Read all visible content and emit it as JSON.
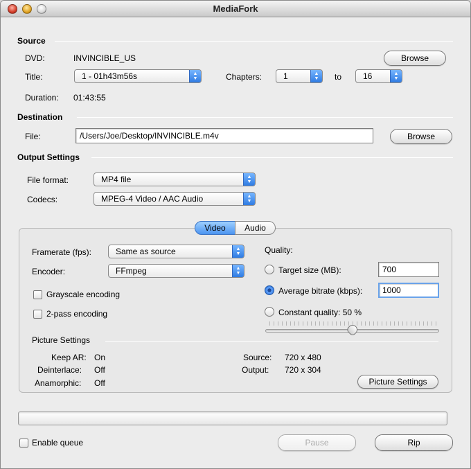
{
  "window": {
    "title": "MediaFork"
  },
  "source": {
    "heading": "Source",
    "dvd_label": "DVD:",
    "dvd_value": "INVINCIBLE_US",
    "title_label": "Title:",
    "title_value": "1 - 01h43m56s",
    "chapters_label": "Chapters:",
    "chapter_start": "1",
    "chapter_to": "to",
    "chapter_end": "16",
    "duration_label": "Duration:",
    "duration_value": "01:43:55",
    "browse_label": "Browse"
  },
  "destination": {
    "heading": "Destination",
    "file_label": "File:",
    "file_value": "/Users/Joe/Desktop/INVINCIBLE.m4v",
    "browse_label": "Browse"
  },
  "output": {
    "heading": "Output Settings",
    "format_label": "File format:",
    "format_value": "MP4 file",
    "codecs_label": "Codecs:",
    "codecs_value": "MPEG-4 Video / AAC Audio"
  },
  "tabs": {
    "video": "Video",
    "audio": "Audio"
  },
  "video": {
    "framerate_label": "Framerate (fps):",
    "framerate_value": "Same as source",
    "encoder_label": "Encoder:",
    "encoder_value": "FFmpeg",
    "grayscale_label": "Grayscale encoding",
    "twopass_label": "2-pass encoding",
    "quality_label": "Quality:",
    "target_size_label": "Target size (MB):",
    "target_size_value": "700",
    "avg_bitrate_label": "Average bitrate (kbps):",
    "avg_bitrate_value": "1000",
    "constant_quality_label": "Constant quality: 50 %",
    "quality_slider": 0.5
  },
  "picture": {
    "heading": "Picture Settings",
    "keep_ar_label": "Keep AR:",
    "keep_ar_value": "On",
    "deinterlace_label": "Deinterlace:",
    "deinterlace_value": "Off",
    "anamorphic_label": "Anamorphic:",
    "anamorphic_value": "Off",
    "source_label": "Source:",
    "source_value": "720 x 480",
    "output_label": "Output:",
    "output_value": "720 x 304",
    "button_label": "Picture Settings"
  },
  "bottom": {
    "enable_queue_label": "Enable queue",
    "pause_label": "Pause",
    "rip_label": "Rip"
  },
  "icons": {
    "popup": "up-down-arrows-icon"
  }
}
